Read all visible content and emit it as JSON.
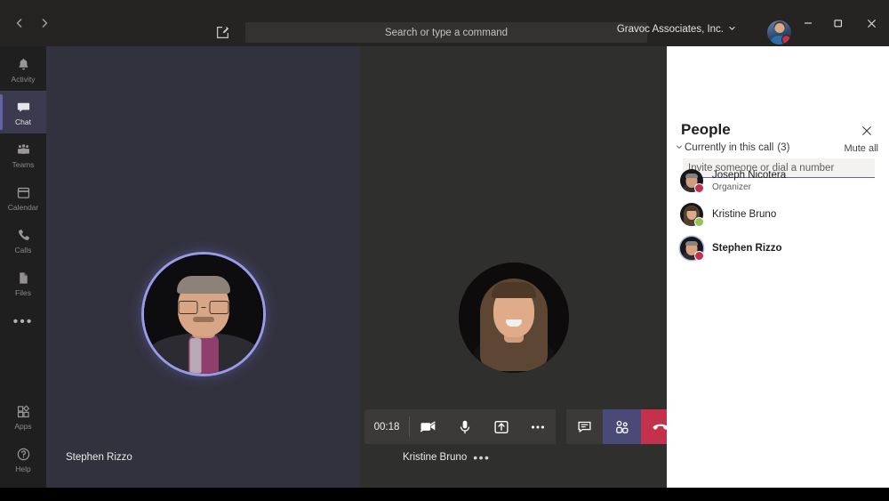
{
  "window": {
    "org_name": "Gravoc Associates, Inc.",
    "back_icon": "chevron-left-icon",
    "forward_icon": "chevron-right-icon",
    "compose_icon": "compose-new-chat-icon",
    "org_chevron_icon": "chevron-down-icon",
    "avatar_icon": "user-avatar",
    "minimize_label": "—",
    "maximize_icon": "restore-icon",
    "close_icon": "close-icon"
  },
  "search": {
    "value": "",
    "placeholder": "Search or type a command"
  },
  "rail": {
    "items": [
      {
        "label": "Activity",
        "icon": "bell-icon",
        "selected": false
      },
      {
        "label": "Chat",
        "icon": "chat-bubble-icon",
        "selected": true
      },
      {
        "label": "Teams",
        "icon": "teams-people-icon",
        "selected": false
      },
      {
        "label": "Calendar",
        "icon": "calendar-icon",
        "selected": false
      },
      {
        "label": "Calls",
        "icon": "phone-icon",
        "selected": false
      },
      {
        "label": "Files",
        "icon": "file-icon",
        "selected": false
      }
    ],
    "overflow_label": "•••",
    "bottom_items": [
      {
        "label": "Apps",
        "icon": "apps-grid-icon"
      },
      {
        "label": "Help",
        "icon": "help-question-icon"
      }
    ]
  },
  "stage": {
    "tiles": [
      {
        "name": "Stephen Rizzo",
        "speaking": true,
        "has_menu": false
      },
      {
        "name": "Kristine Bruno",
        "speaking": false,
        "has_menu": true,
        "menu_icon": "more-options-icon"
      }
    ]
  },
  "callbar": {
    "timer": "00:18",
    "buttons": [
      {
        "name": "camera-off-button",
        "icon": "video-camera-off-icon",
        "state": "off"
      },
      {
        "name": "microphone-button",
        "icon": "microphone-icon",
        "state": "on"
      },
      {
        "name": "share-screen-button",
        "icon": "share-screen-icon",
        "state": "off"
      },
      {
        "name": "more-actions-button",
        "icon": "more-options-icon",
        "state": "off"
      }
    ],
    "chat_button": {
      "name": "show-conversation-button",
      "icon": "chat-bubble-icon"
    },
    "people_button": {
      "name": "show-participants-button",
      "icon": "people-icon",
      "active": true
    },
    "hangup_button": {
      "name": "hang-up-button",
      "icon": "hang-up-phone-icon"
    }
  },
  "panel": {
    "title": "People",
    "close_icon": "close-icon",
    "invite": {
      "value": "",
      "placeholder": "Invite someone or dial a number"
    },
    "section_label": "Currently in this call",
    "section_count": "(3)",
    "collapse_icon": "chevron-down-icon",
    "mute_all_label": "Mute all",
    "participants": [
      {
        "name": "Joseph Nicotera",
        "role": "Organizer",
        "status": "busy",
        "bold": false,
        "ringed": false
      },
      {
        "name": "Kristine Bruno",
        "role": "",
        "status": "available",
        "bold": false,
        "ringed": false
      },
      {
        "name": "Stephen Rizzo",
        "role": "",
        "status": "busy",
        "bold": true,
        "ringed": true
      }
    ]
  },
  "colors": {
    "accent_purple": "#6264a7",
    "active_purple": "#4a4a78",
    "hangup_red": "#c4314b",
    "status_busy": "#c4314b",
    "status_available": "#92c353",
    "titlebar_bg": "#252423",
    "rail_bg": "#201f1f",
    "stage_bg": "#2f2f2e",
    "speaker_tile_bg": "#32323f",
    "panel_bg": "#ffffff"
  }
}
